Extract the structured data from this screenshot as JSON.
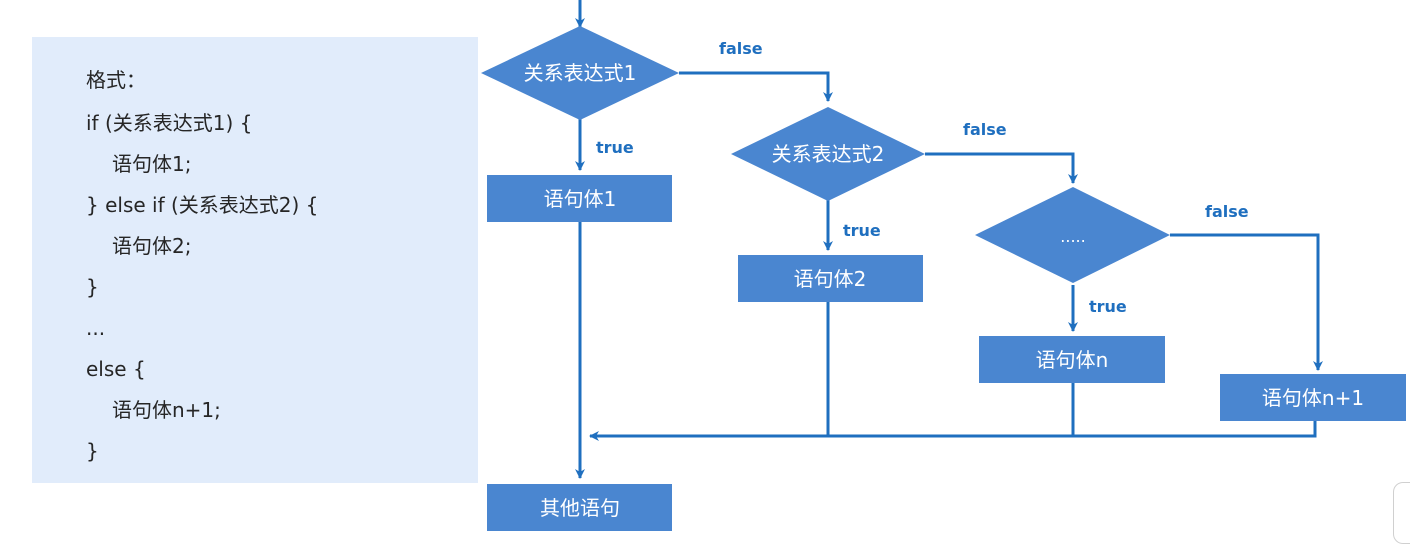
{
  "code": {
    "lines": [
      "格式：",
      "if (关系表达式1) {",
      "语句体1;",
      "} else if (关系表达式2) {",
      "语句体2;",
      "}",
      "...",
      "else {",
      "语句体n+1;",
      "}"
    ]
  },
  "flowchart": {
    "decision1": "关系表达式1",
    "decision2": "关系表达式2",
    "decision3": ".....",
    "stmt1": "语句体1",
    "stmt2": "语句体2",
    "stmtn": "语句体n",
    "stmtn1": "语句体n+1",
    "other": "其他语句",
    "true_label": "true",
    "false_label": "false"
  },
  "colors": {
    "node_fill": "#4a86d0",
    "arrow": "#1f6fbf",
    "panel_bg": "#e1ecfb"
  }
}
